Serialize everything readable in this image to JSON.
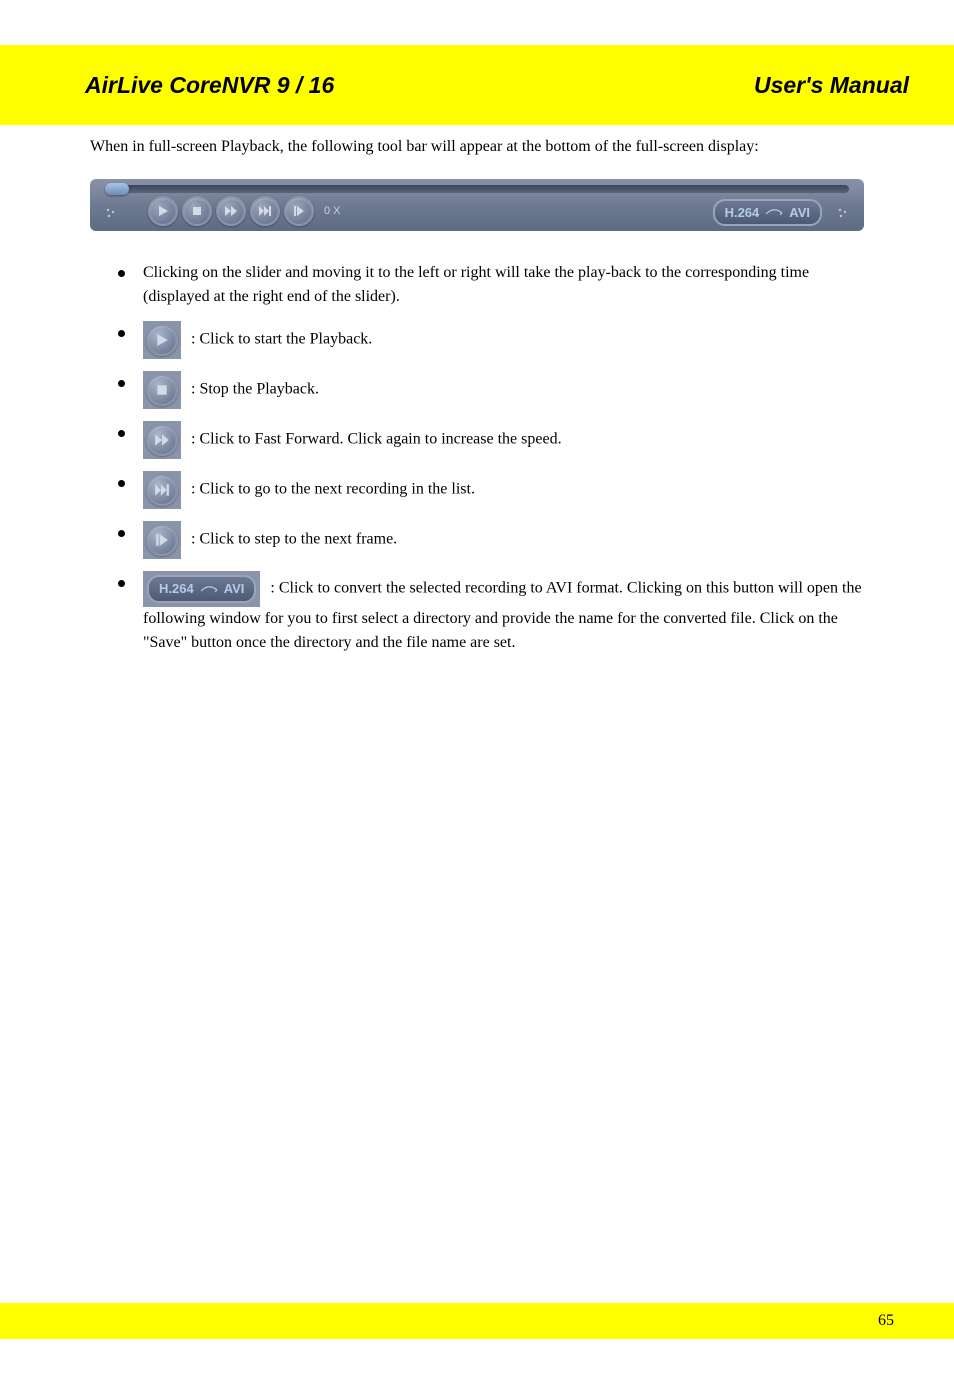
{
  "header": {
    "product": "AirLive CoreNVR 9 / 16",
    "label": "User's Manual"
  },
  "intro": "When in full-screen Playback, the following tool bar will appear at the bottom of the full-screen display:",
  "player": {
    "speed": "0 X",
    "h264_label": "H.264",
    "avi_label": "AVI"
  },
  "bullets": [
    {
      "type": "text-only",
      "text": "Clicking on the slider and moving it to the left or right will take the play-back to the corresponding time (displayed at the right end of the slider)."
    },
    {
      "type": "icon",
      "icon": "play",
      "text": ": Click to start the Playback."
    },
    {
      "type": "icon",
      "icon": "stop",
      "text": ": Stop the Playback."
    },
    {
      "type": "icon",
      "icon": "ff",
      "text": ": Click to Fast Forward. Click again to increase the speed."
    },
    {
      "type": "icon",
      "icon": "next",
      "text": ": Click to go to the next recording in the list."
    },
    {
      "type": "icon",
      "icon": "step",
      "text": ": Click to step to the next frame."
    },
    {
      "type": "h264",
      "text": ": Click to convert the selected recording to AVI format. Clicking on this button will open the following window for you to first select a directory and provide the name for the converted file. Click on the \"Save\" button once the directory and the file name are set."
    }
  ],
  "footer": {
    "page_number": "65"
  }
}
